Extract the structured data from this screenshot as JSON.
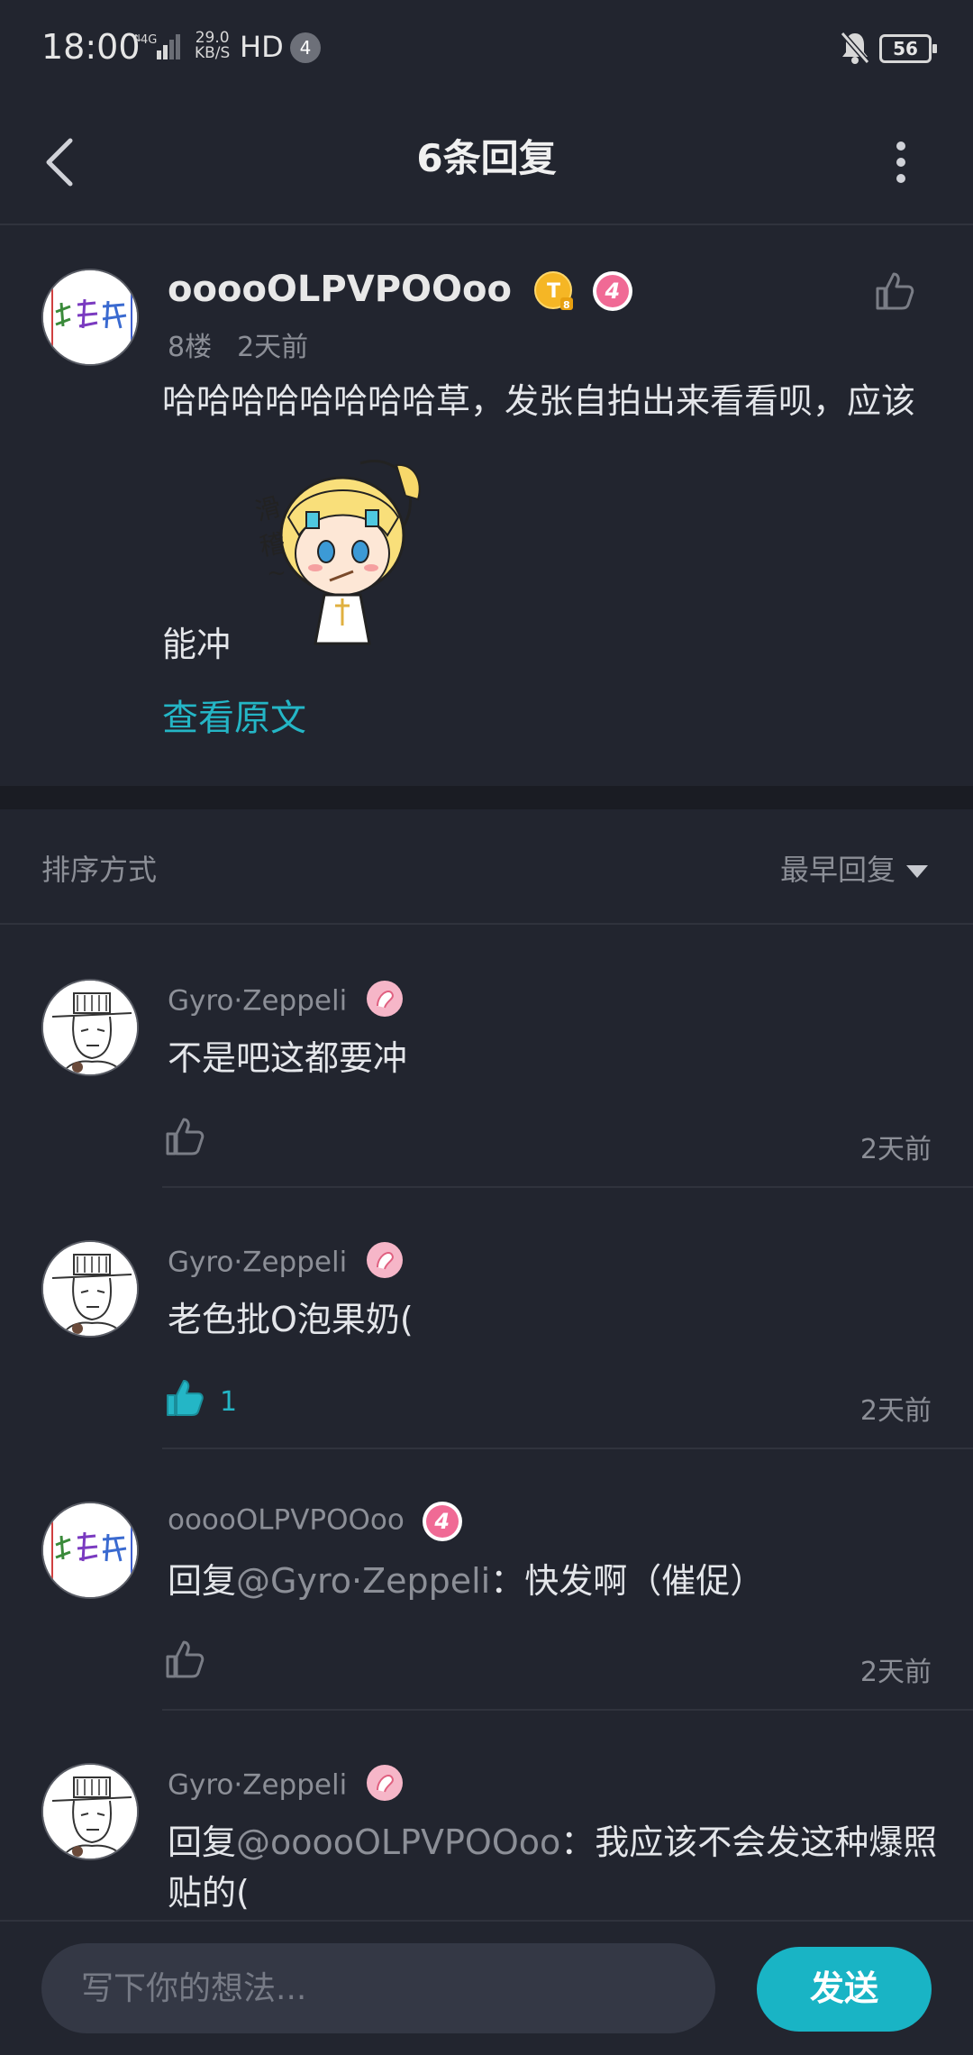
{
  "status_bar": {
    "time": "18:00",
    "network": "4G",
    "speed_top": "29.0",
    "speed_unit": "KB/S",
    "hd": "HD",
    "notif_count": "4",
    "battery": "56"
  },
  "header": {
    "title": "6条回复"
  },
  "post": {
    "username": "ooooOLPVPOOoo",
    "vip_badge": "T",
    "level": "4",
    "floor": "8楼",
    "time": "2天前",
    "text_line1": "哈哈哈哈哈哈哈哈草，发张自拍出来看看呗，应该",
    "text_line2": "能冲",
    "view_original": "查看原文"
  },
  "sort": {
    "label": "排序方式",
    "selected": "最早回复"
  },
  "replies": [
    {
      "username": "Gyro·Zeppeli",
      "text": "不是吧这都要冲",
      "mention": "",
      "mention_text": "",
      "likes": "",
      "liked": false,
      "time": "2天前"
    },
    {
      "username": "Gyro·Zeppeli",
      "text": "老色批O泡果奶(",
      "mention": "",
      "mention_text": "",
      "likes": "1",
      "liked": true,
      "time": "2天前"
    },
    {
      "username": "ooooOLPVPOOoo",
      "level": "4",
      "prefix": "回复",
      "mention": "@Gyro·Zeppeli",
      "text": "：快发啊（催促）",
      "likes": "",
      "liked": false,
      "time": "2天前"
    },
    {
      "username": "Gyro·Zeppeli",
      "prefix": "回复",
      "mention": "@ooooOLPVPOOoo",
      "text": "：我应该不会发这种爆照贴的(",
      "likes": "",
      "liked": false,
      "time": ""
    }
  ],
  "bottom": {
    "placeholder": "写下你的想法...",
    "send": "发送"
  },
  "colors": {
    "accent": "#19b4c5",
    "background": "#22252f",
    "level_badge": "#f06a95"
  }
}
